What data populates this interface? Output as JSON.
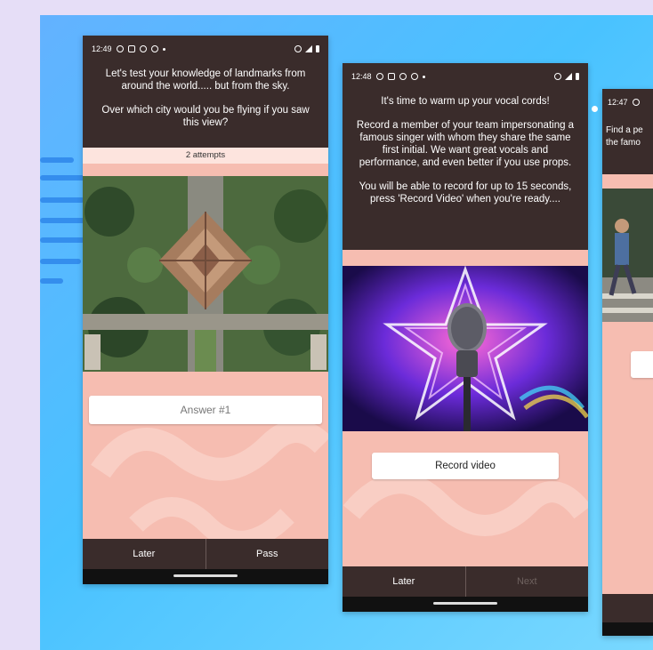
{
  "screen1": {
    "time": "12:49",
    "prompt_line1": "Let's test your knowledge of landmarks from around the world..... but from the sky.",
    "prompt_line2": "Over which city would you be flying if you saw this view?",
    "attempts": "2 attempts",
    "answer_placeholder": "Answer #1",
    "nav_left": "Later",
    "nav_right": "Pass"
  },
  "screen2": {
    "time": "12:48",
    "prompt_line1": "It's time to warm up your vocal cords!",
    "prompt_line2": "Record a member of your team impersonating a famous singer with whom they share the same first initial. We want great vocals and performance, and even better if you use props.",
    "prompt_line3": "You will be able to record for up to 15 seconds, press 'Record Video' when you're ready....",
    "record_button": "Record video",
    "nav_left": "Later",
    "nav_right": "Next"
  },
  "screen3": {
    "time": "12:47",
    "prompt_partial": "Find a pe the famo"
  },
  "colors": {
    "dark": "#3a2c2b",
    "pink": "#f6bdb1",
    "light_pink": "#fde4de",
    "background": "#e6def7",
    "stage_blue": "#49c2ff"
  }
}
